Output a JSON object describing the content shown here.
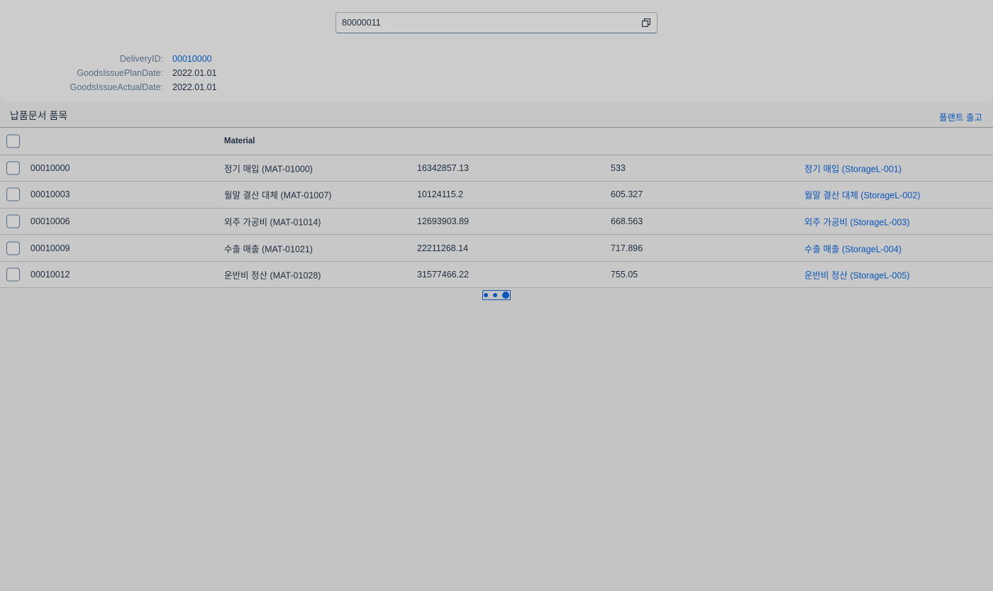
{
  "header": {
    "id_field_value": "80000011",
    "meta": [
      {
        "label": "DeliveryID:",
        "value": "00010000",
        "link": true
      },
      {
        "label": "GoodsIssuePlanDate:",
        "value": "2022.01.01",
        "link": false
      },
      {
        "label": "GoodsIssueActualDate:",
        "value": "2022.01.01",
        "link": false
      }
    ]
  },
  "section": {
    "title": "납품문서 품목",
    "action_label": "플랜트 출고"
  },
  "table": {
    "columns": [
      "",
      "Material",
      "",
      "",
      ""
    ],
    "rows": [
      {
        "id": "00010000",
        "material": "정기 매입 (MAT-01000)",
        "num1": "16342857.13",
        "num2": "533",
        "storage": "정기 매입 (StorageL-001)"
      },
      {
        "id": "00010003",
        "material": "월말 결산 대체 (MAT-01007)",
        "num1": "10124115.2",
        "num2": "605.327",
        "storage": "월말 결산 대체 (StorageL-002)"
      },
      {
        "id": "00010006",
        "material": "외주 가공비 (MAT-01014)",
        "num1": "12693903.89",
        "num2": "668.563",
        "storage": "외주 가공비 (StorageL-003)"
      },
      {
        "id": "00010009",
        "material": "수출 매출 (MAT-01021)",
        "num1": "22211268.14",
        "num2": "717.896",
        "storage": "수출 매출 (StorageL-004)"
      },
      {
        "id": "00010012",
        "material": "운반비 정산 (MAT-01028)",
        "num1": "31577466.22",
        "num2": "755.05",
        "storage": "운반비 정산 (StorageL-005)"
      }
    ]
  },
  "icons": {
    "value_help": "value-help-icon",
    "more": "more-dots-icon"
  },
  "colors": {
    "link": "#0a55b8",
    "text": "#1d2d3e",
    "label": "#556b82"
  }
}
